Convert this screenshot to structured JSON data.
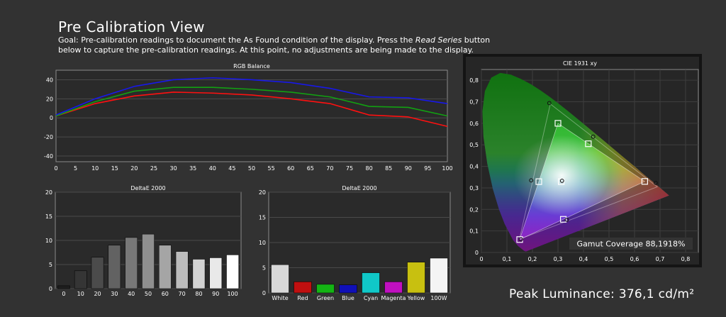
{
  "page": {
    "title": "Pre Calibration View",
    "goal_before": "Goal: Pre-calibration readings to document the As Found condition of the display. Press the ",
    "goal_emph": "Read Series",
    "goal_after": " button below to capture the pre-calibration readings. At this point, no adjustments are being made to the display.",
    "peak_luminance": "Peak Luminance: 376,1 cd/m²",
    "gamut_coverage": "Gamut Coverage 88,1918%"
  },
  "colors": {
    "background": "#323232",
    "plot_bg": "#2a2a2a",
    "red": "#ff1010",
    "green": "#12a012",
    "blue": "#1818e8"
  },
  "chart_data": [
    {
      "type": "line",
      "title": "RGB Balance",
      "x": [
        0,
        10,
        20,
        30,
        40,
        50,
        60,
        70,
        80,
        90,
        100
      ],
      "xticks": [
        0,
        5,
        10,
        15,
        20,
        25,
        30,
        35,
        40,
        45,
        50,
        55,
        60,
        65,
        70,
        75,
        80,
        85,
        90,
        95,
        100
      ],
      "yticks": [
        -40,
        -20,
        0,
        20,
        40
      ],
      "xlim": [
        0,
        100
      ],
      "ylim": [
        -46,
        50
      ],
      "grid": true,
      "series": [
        {
          "color": "#ff1010",
          "values": [
            2,
            15,
            23,
            27,
            26,
            24,
            20,
            15,
            3,
            1,
            -9
          ]
        },
        {
          "color": "#12a012",
          "values": [
            2,
            17,
            28,
            32,
            32,
            30,
            27,
            22,
            12,
            11,
            2
          ]
        },
        {
          "color": "#1818e8",
          "values": [
            3,
            20,
            33,
            40,
            42,
            40,
            37,
            31,
            22,
            21,
            15
          ]
        }
      ]
    },
    {
      "type": "bar",
      "title": "DeltaE 2000",
      "categories": [
        "0",
        "10",
        "20",
        "30",
        "40",
        "50",
        "60",
        "70",
        "80",
        "90",
        "100"
      ],
      "values": [
        0.6,
        3.7,
        6.5,
        9.0,
        10.6,
        11.3,
        9.0,
        7.7,
        6.1,
        6.4,
        7.0
      ],
      "yticks": [
        0,
        5,
        10,
        15,
        20
      ],
      "ylim": [
        0,
        20
      ],
      "grid": true
    },
    {
      "type": "bar",
      "title": "DeltaE 2000",
      "categories": [
        "White",
        "Red",
        "Green",
        "Blue",
        "Cyan",
        "Magenta",
        "Yellow",
        "100W"
      ],
      "values": [
        5.6,
        2.2,
        1.7,
        1.6,
        4.0,
        2.2,
        6.1,
        6.9
      ],
      "colors": [
        "#d8d8d8",
        "#c01010",
        "#14b414",
        "#1010b8",
        "#10c8c8",
        "#c010c0",
        "#c8c010",
        "#f4f4f4"
      ],
      "yticks": [
        0,
        5,
        10,
        15,
        20
      ],
      "ylim": [
        0,
        20
      ],
      "grid": true
    },
    {
      "type": "scatter",
      "title": "CIE 1931 xy",
      "xticks": [
        "0",
        "0,1",
        "0,2",
        "0,3",
        "0,4",
        "0,5",
        "0,6",
        "0,7",
        "0,8"
      ],
      "yticks": [
        "0",
        "0,1",
        "0,2",
        "0,3",
        "0,4",
        "0,5",
        "0,6",
        "0,7",
        "0,8"
      ],
      "xlim": [
        0,
        0.85
      ],
      "ylim": [
        0,
        0.85
      ],
      "target_gamut": [
        [
          0.64,
          0.33
        ],
        [
          0.3,
          0.6
        ],
        [
          0.15,
          0.06
        ]
      ],
      "measured_gamut": [
        [
          0.689,
          0.305
        ],
        [
          0.27,
          0.69
        ],
        [
          0.149,
          0.062
        ]
      ],
      "targets": [
        [
          0.64,
          0.33
        ],
        [
          0.3,
          0.6
        ],
        [
          0.15,
          0.06
        ],
        [
          0.225,
          0.329
        ],
        [
          0.321,
          0.154
        ],
        [
          0.419,
          0.505
        ],
        [
          0.3127,
          0.329
        ]
      ],
      "measured": [
        [
          0.683,
          0.323
        ],
        [
          0.266,
          0.694
        ],
        [
          0.155,
          0.061
        ],
        [
          0.195,
          0.335
        ],
        [
          0.335,
          0.152
        ],
        [
          0.438,
          0.538
        ],
        [
          0.316,
          0.333
        ]
      ]
    }
  ]
}
